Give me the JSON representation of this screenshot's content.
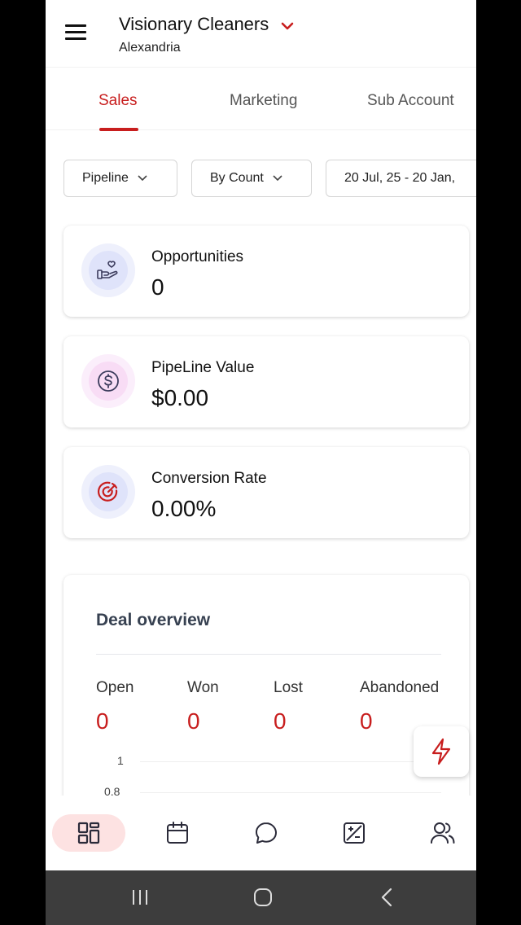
{
  "header": {
    "title": "Visionary Cleaners",
    "subtitle": "Alexandria"
  },
  "tabs": [
    {
      "label": "Sales",
      "active": true
    },
    {
      "label": "Marketing",
      "active": false
    },
    {
      "label": "Sub Account",
      "active": false
    }
  ],
  "filters": {
    "pipeline": "Pipeline",
    "metric": "By Count",
    "date_range": "20 Jul, 25 - 20 Jan,"
  },
  "stats": [
    {
      "label": "Opportunities",
      "value": "0",
      "icon": "hand-heart-icon"
    },
    {
      "label": "PipeLine Value",
      "value": "$0.00",
      "icon": "dollar-circle-icon"
    },
    {
      "label": "Conversion Rate",
      "value": "0.00%",
      "icon": "target-icon"
    }
  ],
  "deal_overview": {
    "title": "Deal overview",
    "columns": [
      {
        "label": "Open",
        "value": "0"
      },
      {
        "label": "Won",
        "value": "0"
      },
      {
        "label": "Lost",
        "value": "0"
      },
      {
        "label": "Abandoned",
        "value": "0"
      }
    ],
    "axis_ticks": [
      "1",
      "0.8"
    ]
  },
  "bottom_nav": [
    {
      "icon": "dashboard-icon",
      "active": true
    },
    {
      "icon": "calendar-icon",
      "active": false
    },
    {
      "icon": "chat-icon",
      "active": false
    },
    {
      "icon": "plus-minus-icon",
      "active": false
    },
    {
      "icon": "contacts-icon",
      "active": false
    }
  ],
  "colors": {
    "accent": "#c81e1e",
    "active_nav_bg": "#fde2e2"
  }
}
